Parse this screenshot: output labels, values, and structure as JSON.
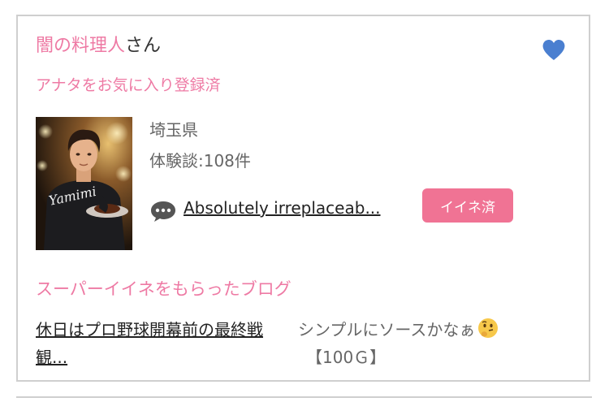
{
  "user": {
    "name": "闇の料理人",
    "suffix": "さん",
    "favorite_status": "アナタをお気に入り登録済",
    "avatar_text": "Yamimi"
  },
  "profile": {
    "prefecture": "埼玉県",
    "review_count": "体験談:108件",
    "comment_preview": "Absolutely irreplaceab...",
    "like_label": "イイネ済"
  },
  "blog": {
    "section_title": "スーパーイイネをもらったブログ",
    "post_title": "休日はプロ野球開幕前の最終戦観...",
    "description": "シンプルにソースかなぁ",
    "price": "【100Ｇ】"
  },
  "colors": {
    "accent_pink": "#ee7aa4",
    "button_pink": "#f07394",
    "heart_blue": "#4a7fd0",
    "border": "#cfcfcf"
  },
  "icons": [
    "heart-icon",
    "speech-bubble-icon",
    "thinking-face-icon"
  ]
}
